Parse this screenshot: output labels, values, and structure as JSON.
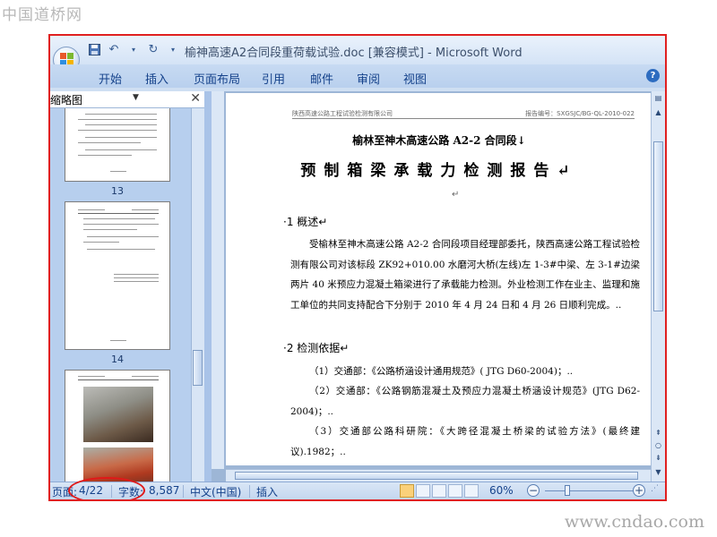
{
  "watermark_top": "中国道桥网",
  "watermark_bottom": "www.cndao.com",
  "window": {
    "title": "榆神高速A2合同段重荷载试验.doc [兼容模式] - Microsoft Word"
  },
  "ribbon": {
    "tabs": [
      "开始",
      "插入",
      "页面布局",
      "引用",
      "邮件",
      "审阅",
      "视图"
    ]
  },
  "nav_pane": {
    "title": "缩略图",
    "thumbnails": [
      {
        "label": "13"
      },
      {
        "label": "14"
      }
    ]
  },
  "document": {
    "header_left": "陕西高速公路工程试验检测有限公司",
    "header_right": "报告编号：SXGSJC/BG-QL-2010-022",
    "heading1": "榆林至神木高速公路 A2-2 合同段↓",
    "heading2": "预制箱梁承载力检测报告↵",
    "blank_mark": "↵",
    "section1_title": "·1  概述↵",
    "section1_paragraph": "受榆林至神木高速公路 A2-2 合同段项目经理部委托，陕西高速公路工程试验检测有限公司对该标段 ZK92+010.00 水磨河大桥(左线)左 1-3#中梁、左 3-1#边梁两片 40 米预应力混凝土箱梁进行了承载能力检测。外业检测工作在业主、监理和施工单位的共同支持配合下分别于 2010 年 4 月 24 日和 4 月 26 日顺利完成。..",
    "section2_title": "·2  检测依据↵",
    "ref1": "（1）交通部：《公路桥涵设计通用规范》( JTG D60-2004)；..",
    "ref2": "（2）交通部：《公路钢筋混凝土及预应力混凝土桥涵设计规范》(JTG D62-2004)；..",
    "ref3": "（3）交通部公路科研院：《大跨径混凝土桥梁的试验方法》(最终建议).1982；.."
  },
  "status_bar": {
    "page_label": "页面:",
    "page_value": "4/22",
    "words_label": "字数:",
    "words_value": "8,587",
    "language": "中文(中国)",
    "mode": "插入",
    "zoom": "60%"
  },
  "colors": {
    "annotation": "#e01818",
    "ribbon_text": "#15428b"
  }
}
